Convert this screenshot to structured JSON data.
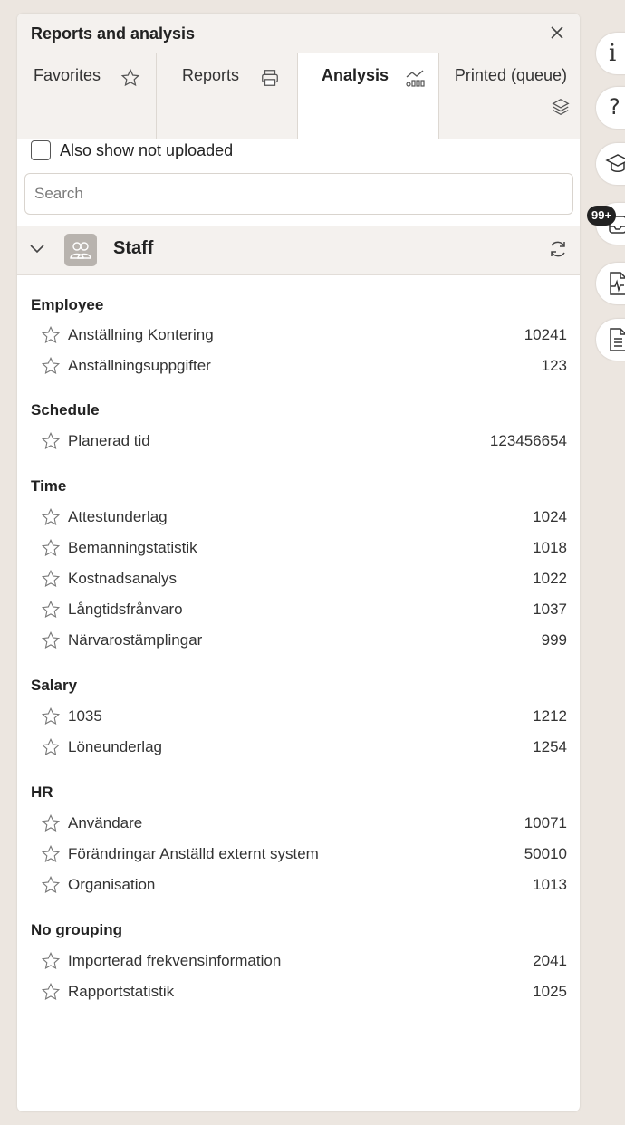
{
  "panel": {
    "title": "Reports and analysis"
  },
  "tabs": [
    {
      "label": "Favorites",
      "icon": "star-icon"
    },
    {
      "label": "Reports",
      "icon": "printer-icon"
    },
    {
      "label": "Analysis",
      "icon": "chart-icon",
      "active": true
    },
    {
      "label": "Printed (queue)",
      "icon": "layers-icon"
    }
  ],
  "filter": {
    "also_show_label": "Also show not uploaded",
    "search_placeholder": "Search"
  },
  "group": {
    "title": "Staff"
  },
  "sections": [
    {
      "title": "Employee",
      "items": [
        {
          "label": "Anställning Kontering",
          "id": "10241"
        },
        {
          "label": "Anställningsuppgifter",
          "id": "123"
        }
      ]
    },
    {
      "title": "Schedule",
      "items": [
        {
          "label": "Planerad tid",
          "id": "123456654"
        }
      ]
    },
    {
      "title": "Time",
      "items": [
        {
          "label": "Attestunderlag",
          "id": "1024"
        },
        {
          "label": "Bemanningstatistik",
          "id": "1018"
        },
        {
          "label": "Kostnadsanalys",
          "id": "1022"
        },
        {
          "label": "Långtidsfrånvaro",
          "id": "1037"
        },
        {
          "label": "Närvarostämplingar",
          "id": "999"
        }
      ]
    },
    {
      "title": "Salary",
      "items": [
        {
          "label": "1035",
          "id": "1212"
        },
        {
          "label": "Löneunderlag",
          "id": "1254"
        }
      ]
    },
    {
      "title": "HR",
      "items": [
        {
          "label": "Användare",
          "id": "10071"
        },
        {
          "label": "Förändringar Anställd externt system",
          "id": "50010"
        },
        {
          "label": "Organisation",
          "id": "1013"
        }
      ]
    },
    {
      "title": "No grouping",
      "items": [
        {
          "label": "Importerad frekvensinformation",
          "id": "2041"
        },
        {
          "label": "Rapportstatistik",
          "id": "1025"
        }
      ]
    }
  ],
  "side_rail": {
    "info_glyph": "i",
    "help_glyph": "?",
    "badge": "99+"
  }
}
